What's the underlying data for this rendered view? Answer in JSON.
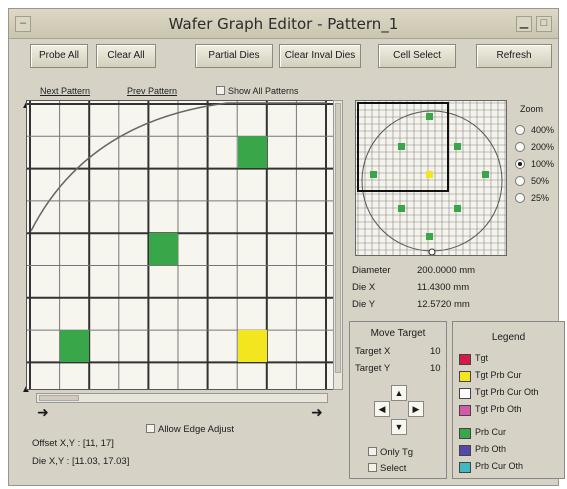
{
  "window": {
    "title": "Wafer Graph Editor - Pattern_1"
  },
  "toolbar": {
    "probe_all": "Probe All",
    "clear_all": "Clear All",
    "partial_dies": "Partial Dies",
    "clear_inval_dies": "Clear Inval Dies",
    "cell_select": "Cell Select",
    "refresh": "Refresh"
  },
  "pattern_nav": {
    "next": "Next Pattern",
    "prev": "Prev Pattern",
    "show_all": "Show All Patterns"
  },
  "zoom": {
    "label": "Zoom",
    "options": [
      "400%",
      "200%",
      "100%",
      "50%",
      "25%"
    ],
    "selected": "100%"
  },
  "wafer_info": {
    "diameter_label": "Diameter",
    "diameter_value": "200.0000 mm",
    "diex_label": "Die X",
    "diex_value": "11.4300 mm",
    "diey_label": "Die Y",
    "diey_value": "12.5720 mm"
  },
  "move_target": {
    "title": "Move Target",
    "target_x_label": "Target X",
    "target_x_value": "10",
    "target_y_label": "Target Y",
    "target_y_value": "10",
    "only_tg": "Only Tg",
    "select": "Select"
  },
  "legend": {
    "title": "Legend",
    "items": [
      {
        "label": "Tgt",
        "color": "#d6184a"
      },
      {
        "label": "Tgt Prb Cur",
        "color": "#f3e51e"
      },
      {
        "label": "Tgt Prb Cur Oth",
        "color": "#ffffff"
      },
      {
        "label": "Tgt Prb Oth",
        "color": "#d35aa8"
      },
      {
        "label": "Prb Cur",
        "color": "#3aa64a"
      },
      {
        "label": "Prb Oth",
        "color": "#5449a6"
      },
      {
        "label": "Prb Cur Oth",
        "color": "#3fb8c4"
      }
    ]
  },
  "edge": {
    "allow_edge_adjust": "Allow Edge Adjust"
  },
  "offset": {
    "offset_text": "Offset X,Y : [11, 17]",
    "die_text": "Die X,Y : [11.03, 17.03]"
  }
}
